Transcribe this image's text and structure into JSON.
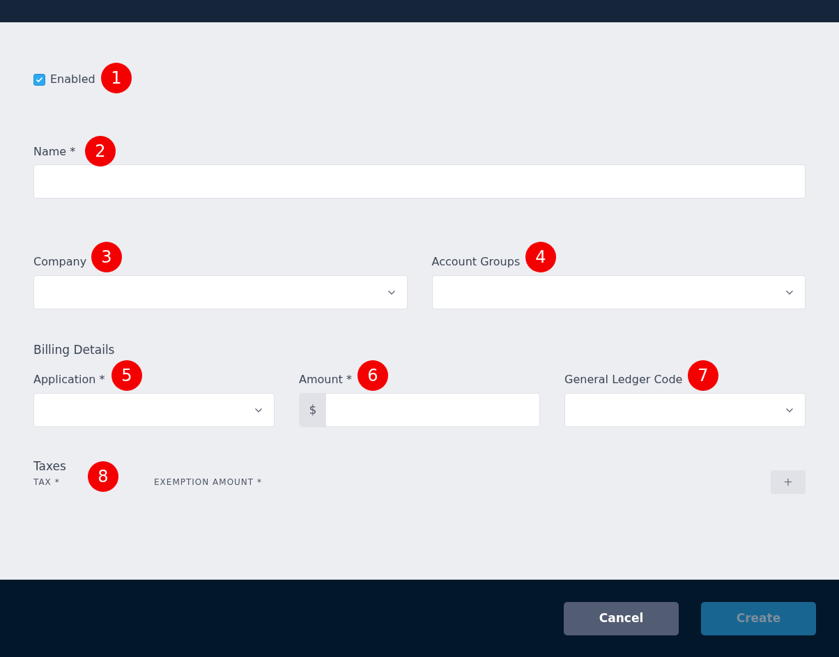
{
  "enabled": {
    "label": "Enabled",
    "checked": true
  },
  "name_field": {
    "label": "Name *"
  },
  "row_1": [
    {
      "label": "Company",
      "kind": "select"
    },
    {
      "label": "Account Groups",
      "kind": "select"
    }
  ],
  "billing": {
    "title": "Billing Details",
    "fields": [
      {
        "label": "Application *",
        "kind": "select"
      },
      {
        "label": "Amount *",
        "kind": "currency",
        "prefix": "$"
      },
      {
        "label": "General Ledger Code",
        "kind": "select"
      }
    ]
  },
  "taxes": {
    "title": "Taxes",
    "columns": [
      "TAX *",
      "EXEMPTION AMOUNT *"
    ],
    "add_button": "+"
  },
  "footer_buttons": [
    {
      "label": "Cancel",
      "kind": "secondary",
      "disabled": false
    },
    {
      "label": "Create",
      "kind": "primary",
      "disabled": true
    }
  ],
  "markers": [
    "1",
    "2",
    "3",
    "4",
    "5",
    "6",
    "7",
    "8"
  ]
}
